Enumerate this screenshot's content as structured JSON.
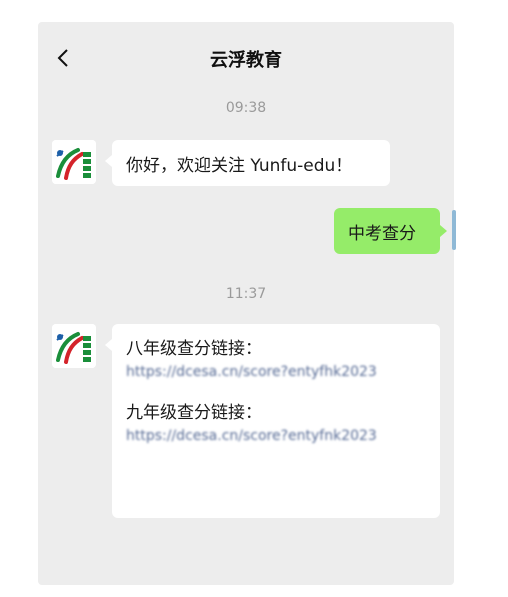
{
  "header": {
    "back_icon": "chevron-left-icon",
    "title": "云浮教育"
  },
  "messages": {
    "time1": "09:38",
    "welcome": "你好，欢迎关注 Yunfu-edu！",
    "user_query": "中考查分",
    "time2": "11:37",
    "reply": {
      "grade8_label": "八年级查分链接：",
      "grade8_link": "https://dcesa.cn/score?entyfhk2023",
      "grade9_label": "九年级查分链接：",
      "grade9_link": "https://dcesa.cn/score?entyfnk2023"
    }
  },
  "colors": {
    "background": "#ededed",
    "self_bubble": "#95ec69",
    "link": "#576b95"
  }
}
